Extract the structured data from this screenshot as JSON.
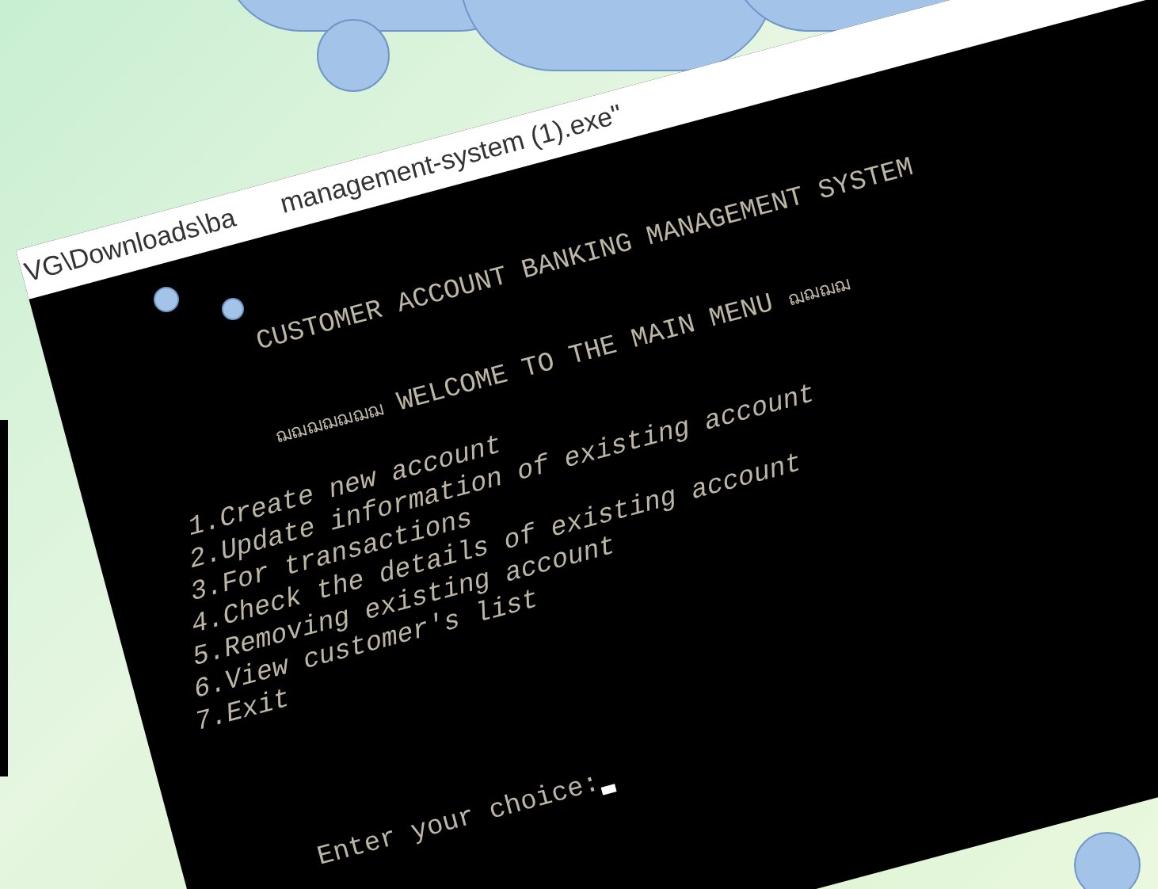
{
  "window": {
    "title_parts": [
      "VG\\Downloads\\ba",
      "management-system (1).exe\""
    ]
  },
  "console": {
    "heading": "CUSTOMER ACCOUNT BANKING MANAGEMENT SYSTEM",
    "welcome": {
      "ornament_left": "ฌฌฌฌฌฌฌ",
      "text": "WELCOME TO THE MAIN MENU",
      "ornament_right": "ฌฌฌฌ"
    },
    "menu_items": [
      "1.Create new account",
      "2.Update information of existing account",
      "3.For transactions",
      "4.Check the details of existing account",
      "5.Removing existing account",
      "6.View customer's list",
      "7.Exit"
    ],
    "prompt": "Enter your choice:"
  }
}
